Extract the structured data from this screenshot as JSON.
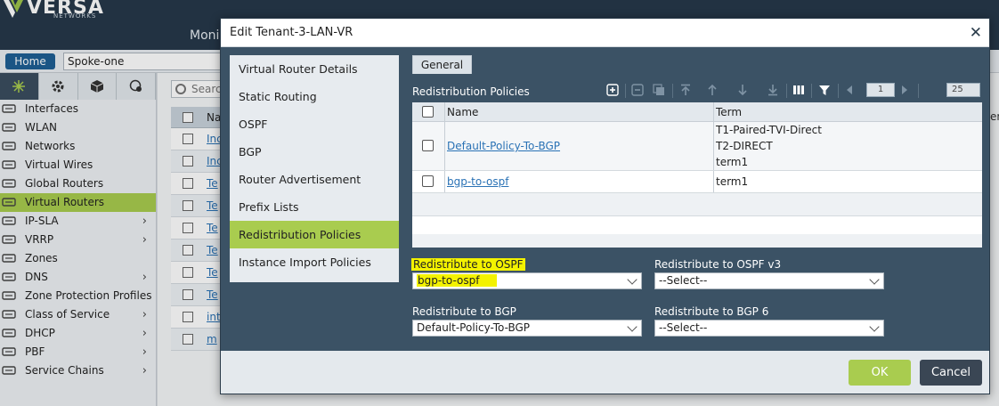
{
  "app": {
    "logo_text": "VERSA",
    "logo_sub": "NETWORKS",
    "top_nav_partial": "Moni",
    "home_label": "Home",
    "appliance": "Spoke-one"
  },
  "sidebar": {
    "items": [
      {
        "label": "Interfaces",
        "icon": "interfaces-icon",
        "has_children": false,
        "active": false
      },
      {
        "label": "WLAN",
        "icon": "wifi-icon",
        "has_children": false,
        "active": false
      },
      {
        "label": "Networks",
        "icon": "network-icon",
        "has_children": false,
        "active": false
      },
      {
        "label": "Virtual Wires",
        "icon": "virtual-wire-icon",
        "has_children": false,
        "active": false
      },
      {
        "label": "Global Routers",
        "icon": "router-icon",
        "has_children": false,
        "active": false
      },
      {
        "label": "Virtual Routers",
        "icon": "router-icon",
        "has_children": false,
        "active": true
      },
      {
        "label": "IP-SLA",
        "icon": "sla-icon",
        "has_children": true,
        "active": false
      },
      {
        "label": "VRRP",
        "icon": "vrrp-icon",
        "has_children": true,
        "active": false
      },
      {
        "label": "Zones",
        "icon": "zone-icon",
        "has_children": false,
        "active": false
      },
      {
        "label": "DNS",
        "icon": "dns-icon",
        "has_children": true,
        "active": false
      },
      {
        "label": "Zone Protection Profiles",
        "icon": "zone-icon",
        "has_children": false,
        "active": false
      },
      {
        "label": "Class of Service",
        "icon": "cos-icon",
        "has_children": true,
        "active": false
      },
      {
        "label": "DHCP",
        "icon": "dhcp-icon",
        "has_children": true,
        "active": false
      },
      {
        "label": "PBF",
        "icon": "pbf-icon",
        "has_children": true,
        "active": false
      },
      {
        "label": "Service Chains",
        "icon": "gear-icon",
        "has_children": true,
        "active": false
      }
    ]
  },
  "background_list": {
    "search_placeholder": "Searc",
    "header_partial": "Na",
    "right_header_partial": "em",
    "rows": [
      "Inc",
      "Inc",
      "Te",
      "Te",
      "Te",
      "Te",
      "Te",
      "Te",
      "int",
      "m"
    ]
  },
  "modal": {
    "title": "Edit Tenant-3-LAN-VR",
    "close_glyph": "✕",
    "nav": [
      {
        "label": "Virtual Router Details",
        "active": false
      },
      {
        "label": "Static Routing",
        "active": false
      },
      {
        "label": "OSPF",
        "active": false
      },
      {
        "label": "BGP",
        "active": false
      },
      {
        "label": "Router Advertisement",
        "active": false
      },
      {
        "label": "Prefix Lists",
        "active": false
      },
      {
        "label": "Redistribution Policies",
        "active": true
      },
      {
        "label": "Instance Import Policies",
        "active": false
      }
    ],
    "tab": "General",
    "section_title": "Redistribution Policies",
    "pager": {
      "page": "1",
      "page_size": "25"
    },
    "grid": {
      "columns": [
        "Name",
        "Term"
      ],
      "rows": [
        {
          "name": "Default-Policy-To-BGP",
          "terms": [
            "T1-Paired-TVI-Direct",
            "T2-DIRECT",
            "term1"
          ]
        },
        {
          "name": "bgp-to-ospf",
          "terms": [
            "term1"
          ]
        }
      ]
    },
    "fields": {
      "ospf": {
        "label": "Redistribute to OSPF",
        "value": "bgp-to-ospf"
      },
      "ospf_v3": {
        "label": "Redistribute to OSPF v3",
        "value": "--Select--"
      },
      "bgp": {
        "label": "Redistribute to BGP",
        "value": "Default-Policy-To-BGP"
      },
      "bgp6": {
        "label": "Redistribute to BGP 6",
        "value": "--Select--"
      }
    },
    "ok_label": "OK",
    "cancel_label": "Cancel"
  },
  "colors": {
    "accent_green": "#a9cc4f",
    "modal_bg": "#3b5265",
    "highlight_yellow": "#f3f200",
    "link_blue": "#2a72b5"
  }
}
